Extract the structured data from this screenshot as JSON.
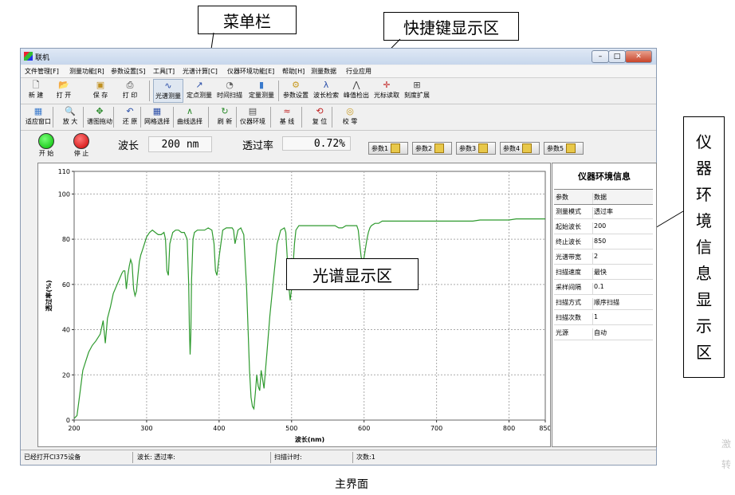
{
  "callouts": {
    "menubar_label": "菜单栏",
    "shortcut_label": "快捷键显示区",
    "spectrum_label": "光谱显示区",
    "instrument_label": [
      "仪",
      "器",
      "环",
      "境",
      "信",
      "息",
      "显",
      "示",
      "区"
    ]
  },
  "caption": "主界面",
  "watermark": [
    "激",
    "转"
  ],
  "window": {
    "title": "联机",
    "controls": [
      "–",
      "□",
      "✕"
    ]
  },
  "menubar": {
    "items": [
      "文件管理[F]",
      "测量功能[R]",
      "参数设置[S]",
      "工具[T]",
      "光谱计算[C]",
      "仪器环境功能[E]",
      "帮助[H]",
      "测量数据",
      "行业应用"
    ]
  },
  "toolbar1": {
    "file_buttons": [
      {
        "label": "新 建",
        "icon": "new-file-icon"
      },
      {
        "label": "打 开",
        "icon": "open-folder-icon"
      },
      {
        "label": "保 存",
        "icon": "save-disk-icon"
      },
      {
        "label": "打 印",
        "icon": "printer-icon"
      }
    ],
    "measure_buttons": [
      {
        "label": "光谱测量",
        "icon": "spectrum-icon"
      },
      {
        "label": "定点测量",
        "icon": "fixed-point-icon"
      },
      {
        "label": "时间扫描",
        "icon": "clock-icon"
      },
      {
        "label": "定量测量",
        "icon": "bar-chart-icon"
      }
    ],
    "tool_buttons": [
      {
        "label": "参数设置",
        "icon": "params-icon"
      },
      {
        "label": "波长检索",
        "icon": "lambda-icon"
      },
      {
        "label": "峰值检出",
        "icon": "peak-icon"
      },
      {
        "label": "光标读取",
        "icon": "crosshair-icon"
      },
      {
        "label": "刻度扩展",
        "icon": "scale-expand-icon"
      }
    ]
  },
  "toolbar2": {
    "buttons": [
      {
        "label": "适应窗口",
        "icon": "fit-window-icon"
      },
      {
        "label": "放 大",
        "icon": "zoom-in-icon"
      },
      {
        "label": "谱图拖动",
        "icon": "drag-icon"
      },
      {
        "label": "还 原",
        "icon": "restore-icon"
      },
      {
        "label": "网格选择",
        "icon": "grid-icon"
      },
      {
        "label": "曲线选择",
        "icon": "curve-icon"
      },
      {
        "label": "刷 新",
        "icon": "refresh-icon"
      },
      {
        "label": "仪器环境",
        "icon": "instrument-icon"
      },
      {
        "label": "基 线",
        "icon": "baseline-icon"
      },
      {
        "label": "复 位",
        "icon": "reset-icon"
      },
      {
        "label": "校 零",
        "icon": "zero-icon"
      }
    ]
  },
  "control_bar": {
    "start_label": "开 始",
    "stop_label": "停 止",
    "wavelength_label": "波长",
    "wavelength_value": "200 nm",
    "transmittance_label": "透过率",
    "transmittance_value": "0.72%",
    "param_buttons": [
      "参数1",
      "参数2",
      "参数3",
      "参数4",
      "参数5"
    ]
  },
  "chart_data": {
    "type": "line",
    "xlabel": "波长(nm)",
    "ylabel": "透过率(%)",
    "xlim": [
      200,
      850
    ],
    "ylim": [
      0,
      110
    ],
    "xticks": [
      200,
      300,
      400,
      500,
      600,
      700,
      800,
      850
    ],
    "yticks": [
      0,
      20,
      40,
      60,
      80,
      100,
      110
    ],
    "grid": true,
    "line_color": "#2e9a2e",
    "series": [
      {
        "x": [
          200,
          204,
          208,
          212,
          216,
          220,
          225,
          230,
          236,
          240,
          243,
          246,
          250,
          254,
          258,
          262,
          266,
          268,
          270,
          272,
          274,
          276,
          278,
          280,
          282,
          284,
          286,
          288,
          290,
          292,
          294,
          297,
          300,
          304,
          308,
          312,
          316,
          320,
          324,
          326,
          328,
          330,
          332,
          336,
          340,
          344,
          348,
          352,
          356,
          358,
          359,
          360,
          361,
          362,
          364,
          366,
          370,
          375,
          380,
          385,
          390,
          393,
          395,
          397,
          400,
          405,
          410,
          414,
          418,
          420,
          422,
          426,
          430,
          434,
          436,
          438,
          440,
          442,
          444,
          446,
          448,
          450,
          452,
          454,
          456,
          458,
          460,
          462,
          464,
          466,
          470,
          475,
          480,
          485,
          490,
          492,
          494,
          496,
          498,
          500,
          502,
          504,
          506,
          508,
          510,
          514,
          520,
          525,
          530,
          535,
          540,
          545,
          550,
          555,
          560,
          565,
          570,
          575,
          580,
          585,
          590,
          592,
          594,
          596,
          598,
          600,
          602,
          604,
          606,
          608,
          610,
          615,
          620,
          625,
          630,
          635,
          640,
          650,
          660,
          670,
          680,
          690,
          700,
          710,
          720,
          730,
          740,
          750,
          760,
          770,
          780,
          790,
          800,
          810,
          820,
          830,
          840,
          850
        ],
        "values": [
          0.7,
          2,
          12,
          22,
          26,
          30,
          33,
          35,
          38,
          44,
          34,
          45,
          50,
          56,
          59,
          62,
          65,
          66,
          66,
          58,
          64,
          68,
          71,
          69,
          58,
          55,
          57,
          64,
          70,
          73,
          75,
          78,
          81,
          83,
          84,
          83,
          82,
          82,
          83,
          80,
          66,
          64,
          78,
          83,
          84,
          84,
          83,
          83,
          80,
          60,
          40,
          29,
          38,
          62,
          80,
          83,
          84,
          84,
          84,
          85,
          84,
          78,
          66,
          64,
          72,
          84,
          85,
          85,
          85,
          84,
          78,
          84,
          85,
          82,
          70,
          58,
          40,
          22,
          10,
          6,
          5,
          12,
          20,
          15,
          13,
          22,
          18,
          14,
          22,
          30,
          46,
          62,
          78,
          84,
          85,
          83,
          72,
          60,
          53,
          58,
          68,
          78,
          84,
          85,
          86,
          86,
          86,
          86,
          86,
          86,
          86,
          86,
          86,
          86,
          86,
          85,
          85,
          86,
          86,
          86,
          86,
          84,
          78,
          72,
          70,
          72,
          76,
          80,
          83,
          85,
          86,
          87,
          87,
          88,
          88,
          88,
          88,
          88,
          88,
          88,
          88,
          88,
          88,
          88,
          88,
          88,
          88,
          88,
          88.5,
          88.5,
          88.5,
          88.5,
          88.5,
          89,
          89,
          89,
          89,
          89
        ]
      }
    ]
  },
  "info_panel": {
    "title": "仪器环境信息",
    "header": {
      "key": "参数",
      "value": "数据"
    },
    "rows": [
      {
        "key": "测量模式",
        "value": "透过率"
      },
      {
        "key": "起始波长",
        "value": "200"
      },
      {
        "key": "终止波长",
        "value": "850"
      },
      {
        "key": "光谱带宽",
        "value": "2"
      },
      {
        "key": "扫描速度",
        "value": "最快"
      },
      {
        "key": "采样间隔",
        "value": "0.1"
      },
      {
        "key": "扫描方式",
        "value": "顺序扫描"
      },
      {
        "key": "扫描次数",
        "value": "1"
      },
      {
        "key": "光源",
        "value": "自动"
      }
    ]
  },
  "statusbar": {
    "device": "已经打开CI375设备",
    "wave_trans": "波长: 透过率:",
    "scan_timer": "扫描计时:",
    "count": "次数:1"
  }
}
